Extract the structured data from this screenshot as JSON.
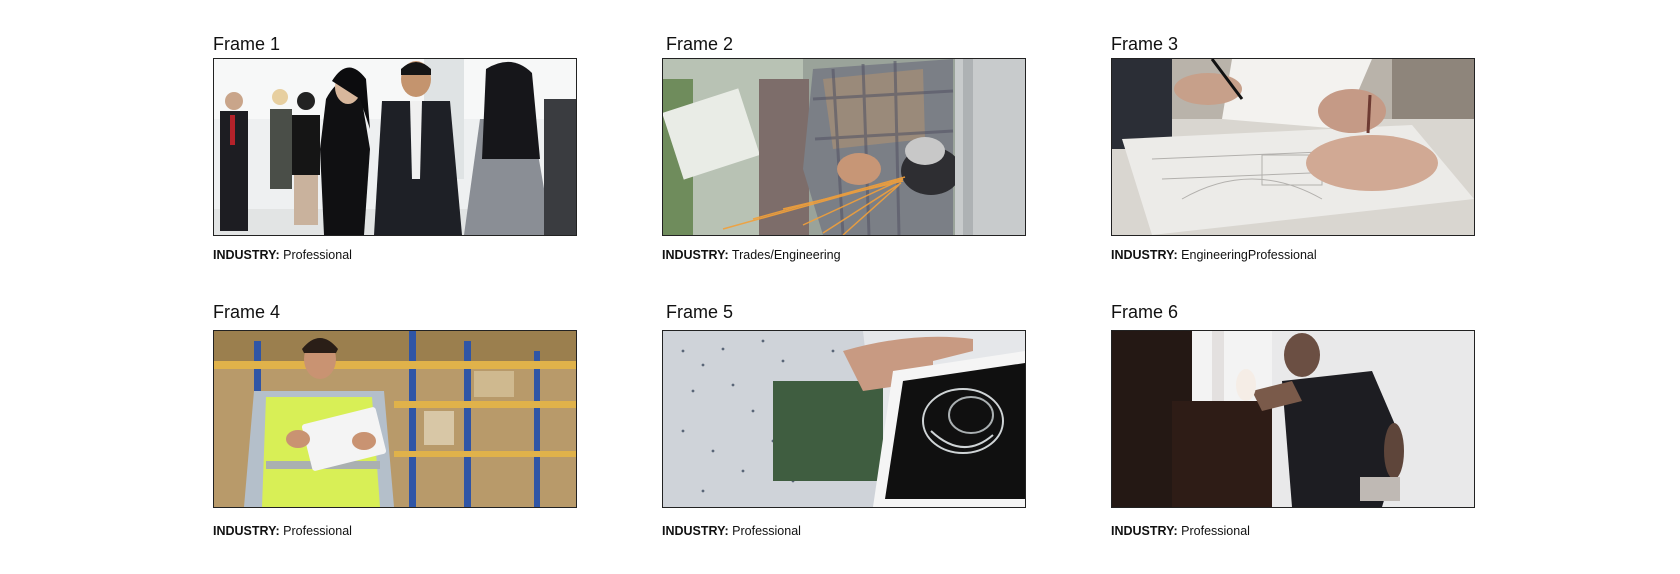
{
  "frames": [
    {
      "title": "Frame 1",
      "industry_label": "INDUSTRY:",
      "industry_value": "Professional"
    },
    {
      "title": "Frame 2",
      "industry_label": "INDUSTRY:",
      "industry_value": "Trades/Engineering"
    },
    {
      "title": "Frame 3",
      "industry_label": "INDUSTRY:",
      "industry_value": "EngineeringProfessional"
    },
    {
      "title": "Frame 4",
      "industry_label": "INDUSTRY:",
      "industry_value": "Professional"
    },
    {
      "title": "Frame 5",
      "industry_label": "INDUSTRY:",
      "industry_value": "Professional"
    },
    {
      "title": "Frame 6",
      "industry_label": "INDUSTRY:",
      "industry_value": "Professional"
    }
  ]
}
